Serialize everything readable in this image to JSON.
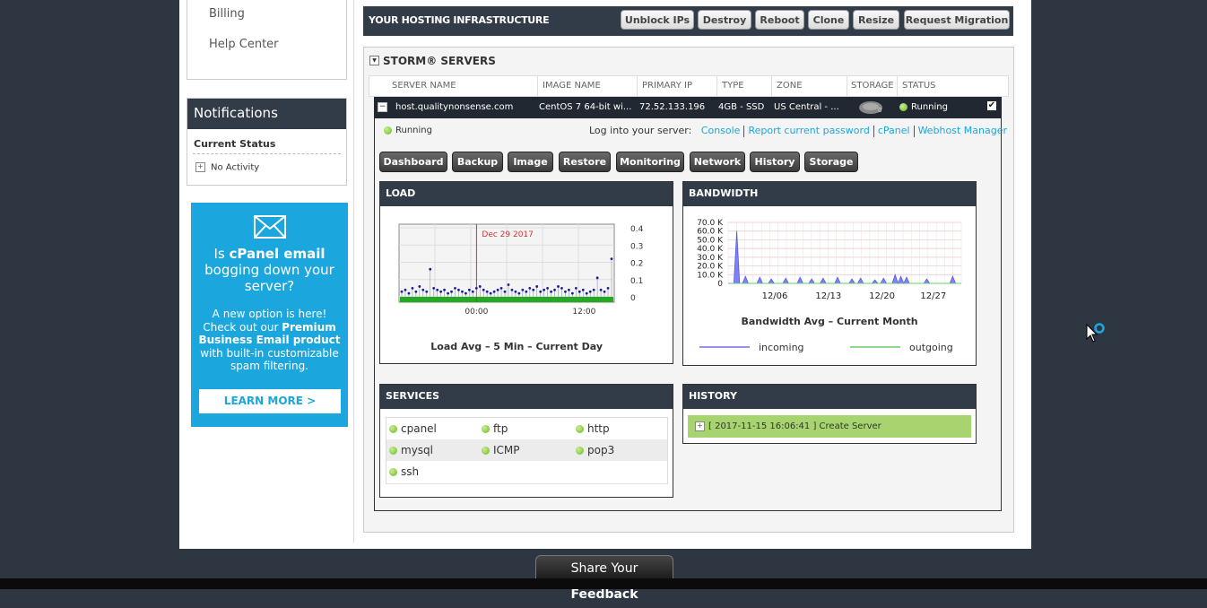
{
  "nav": {
    "billing": "Billing",
    "help_center": "Help Center"
  },
  "notifications": {
    "title": "Notifications",
    "current_status_label": "Current Status",
    "activity": "No Activity"
  },
  "ad": {
    "line1_pre": "Is ",
    "line1_bold": "cPanel email",
    "line2": "bogging down your",
    "line3": "server?",
    "p1": "A new option is here!",
    "p2_pre": "Check out our ",
    "p2_bold": "Premium",
    "p3_bold": "Business Email product",
    "p4": "with built-in customizable",
    "p5": "spam filtering.",
    "button": "LEARN MORE >"
  },
  "infra": {
    "title": "YOUR HOSTING INFRASTRUCTURE",
    "buttons": [
      "Unblock IPs",
      "Destroy",
      "Reboot",
      "Clone",
      "Resize",
      "Request Migration"
    ]
  },
  "storm": {
    "title": "STORM® SERVERS",
    "columns": [
      "SERVER NAME",
      "IMAGE NAME",
      "PRIMARY IP",
      "TYPE",
      "ZONE",
      "STORAGE",
      "STATUS"
    ],
    "server": {
      "name": "host.qualitynonsense.com",
      "image": "CentOS 7 64-bit wi...",
      "ip": "72.52.133.196",
      "type": "4GB - SSD",
      "zone": "US Central - ...",
      "storage_badge": "0",
      "status": "Running"
    }
  },
  "detail": {
    "status": "Running",
    "login_label": "Log into your server:",
    "links": [
      "Console",
      "Report current password",
      "cPanel",
      "Webhost Manager"
    ],
    "buttons": [
      "Dashboard",
      "Backup",
      "Image",
      "Restore",
      "Monitoring",
      "Network",
      "History",
      "Storage"
    ]
  },
  "load": {
    "title": "LOAD",
    "caption": "Load Avg – 5 Min – Current Day"
  },
  "bandwidth": {
    "title": "BANDWIDTH",
    "caption": "Bandwidth Avg – Current Month",
    "legend_in": "incoming",
    "legend_out": "outgoing"
  },
  "services": {
    "title": "SERVICES",
    "items": [
      "cpanel",
      "ftp",
      "http",
      "mysql",
      "ICMP",
      "pop3",
      "ssh"
    ]
  },
  "history": {
    "title": "HISTORY",
    "entry": "[ 2017-11-15 16:06:41 ] Create Server"
  },
  "feedback": {
    "pre": "Share Your ",
    "bold": "Feedback"
  },
  "colors": {
    "dark_bar": "#323b48",
    "accent": "#1ba6dd",
    "running": "#6fb42c",
    "history_row": "#a8d46f"
  },
  "chart_data": [
    {
      "type": "scatter",
      "title": "Load Avg – 5 Min – Current Day",
      "x_tick_labels": [
        "00:00",
        "12:00"
      ],
      "y_ticks": [
        0,
        0.1,
        0.2,
        0.3,
        0.4
      ],
      "ylim": [
        0,
        0.4
      ],
      "annotation": "Dec 29 2017",
      "series": [
        {
          "values": [
            0.03,
            0.04,
            0.02,
            0.05,
            0.03,
            0.06,
            0.04,
            0.03,
            0.16,
            0.05,
            0.04,
            0.03,
            0.04,
            0.02,
            0.03,
            0.05,
            0.04,
            0.03,
            0.02,
            0.04,
            0.03,
            0.05,
            0.06,
            0.04,
            0.03,
            0.02,
            0.03,
            0.04,
            0.05,
            0.03,
            0.07,
            0.04,
            0.03,
            0.02,
            0.04,
            0.03,
            0.05,
            0.04,
            0.06,
            0.03,
            0.04,
            0.05,
            0.03,
            0.04,
            0.06,
            0.05,
            0.03,
            0.04,
            0.02,
            0.05,
            0.03,
            0.04,
            0.02,
            0.03,
            0.04,
            0.11,
            0.04,
            0.03,
            0.05,
            0.22
          ]
        }
      ]
    },
    {
      "type": "area",
      "title": "Bandwidth Avg – Current Month",
      "x_tick_labels": [
        "12/06",
        "12/13",
        "12/20",
        "12/27"
      ],
      "y_ticks": [
        "0",
        "10.0 K",
        "20.0 K",
        "30.0 K",
        "40.0 K",
        "50.0 K",
        "60.0 K",
        "70.0 K"
      ],
      "ylim": [
        0,
        70000
      ],
      "series": [
        {
          "name": "incoming",
          "values": [
            0,
            0,
            0,
            60000,
            0,
            0,
            8000,
            0,
            0,
            0,
            0,
            7000,
            0,
            0,
            0,
            5000,
            0,
            0,
            0,
            0,
            6000,
            0,
            0,
            0,
            0,
            7000,
            0,
            0,
            0,
            5000,
            0,
            0,
            0,
            6000,
            0,
            0,
            0,
            0,
            7000,
            0,
            0,
            0,
            0,
            5000,
            0,
            0,
            6000,
            0,
            0,
            0,
            0,
            4000,
            0,
            0,
            6000,
            0,
            0,
            0,
            10000,
            0,
            8000,
            0,
            7000,
            0,
            0,
            0,
            0,
            0,
            0,
            5000,
            0,
            0,
            0,
            0,
            0,
            0,
            0,
            0,
            8000,
            0,
            0,
            0
          ]
        },
        {
          "name": "outgoing",
          "values": [
            0,
            0,
            0,
            0,
            0,
            0,
            0,
            0,
            0,
            0,
            0,
            0,
            0,
            0,
            0,
            0,
            0,
            0,
            0,
            0,
            0,
            0,
            0,
            0,
            0,
            0,
            0,
            0,
            0,
            0,
            0,
            0,
            0,
            0,
            0,
            0,
            0,
            0,
            0,
            0,
            0,
            0,
            0,
            0,
            0,
            0,
            0,
            0,
            0,
            0,
            0,
            0,
            0,
            0,
            0,
            0,
            0,
            0,
            0,
            0,
            0,
            0,
            0,
            0,
            0,
            0,
            0,
            0,
            0,
            0,
            0,
            0,
            0,
            0,
            0,
            0,
            0,
            0,
            0,
            0,
            0,
            0
          ]
        }
      ]
    }
  ]
}
